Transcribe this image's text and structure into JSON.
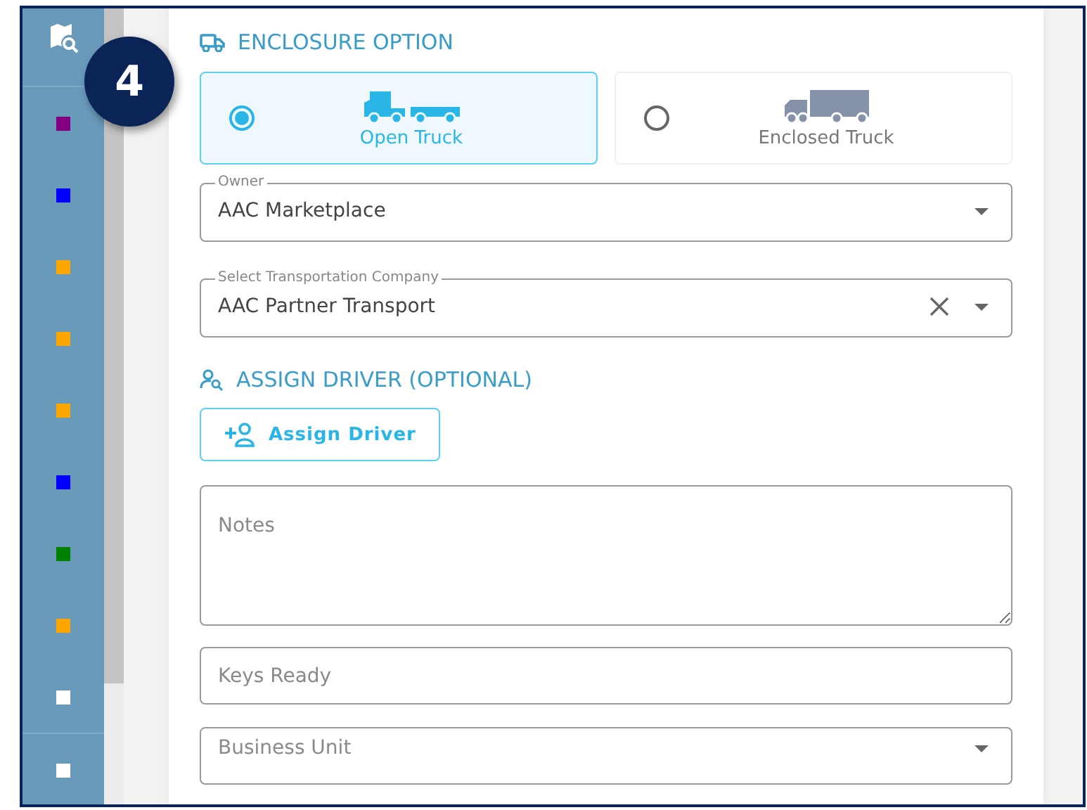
{
  "step_badge": "4",
  "sidebar": {
    "items": [
      {
        "color": "#800080"
      },
      {
        "color": "#0000ff"
      },
      {
        "color": "#ffa500"
      },
      {
        "color": "#ffa500"
      },
      {
        "color": "#ffa500"
      },
      {
        "color": "#0000ff"
      },
      {
        "color": "#008000"
      },
      {
        "color": "#ffa500"
      },
      {
        "color": "#ffffff"
      },
      {
        "color": "#ffffff"
      }
    ]
  },
  "enclosure": {
    "heading": "ENCLOSURE OPTION",
    "options": [
      {
        "label": "Open Truck",
        "selected": true,
        "kind": "open"
      },
      {
        "label": "Enclosed Truck",
        "selected": false,
        "kind": "enclosed"
      }
    ]
  },
  "fields": [
    {
      "kind": "select",
      "label": "Owner",
      "value": "AAC Marketplace",
      "clearable": false
    },
    {
      "kind": "select",
      "label": "Select Transportation Company",
      "value": "AAC Partner Transport",
      "clearable": true
    }
  ],
  "driver": {
    "heading": "ASSIGN DRIVER (OPTIONAL)",
    "button": "Assign Driver"
  },
  "more_fields": [
    {
      "kind": "textarea",
      "placeholder": "Notes"
    },
    {
      "kind": "text",
      "placeholder": "Keys Ready"
    },
    {
      "kind": "select",
      "placeholder": "Business Unit"
    }
  ]
}
